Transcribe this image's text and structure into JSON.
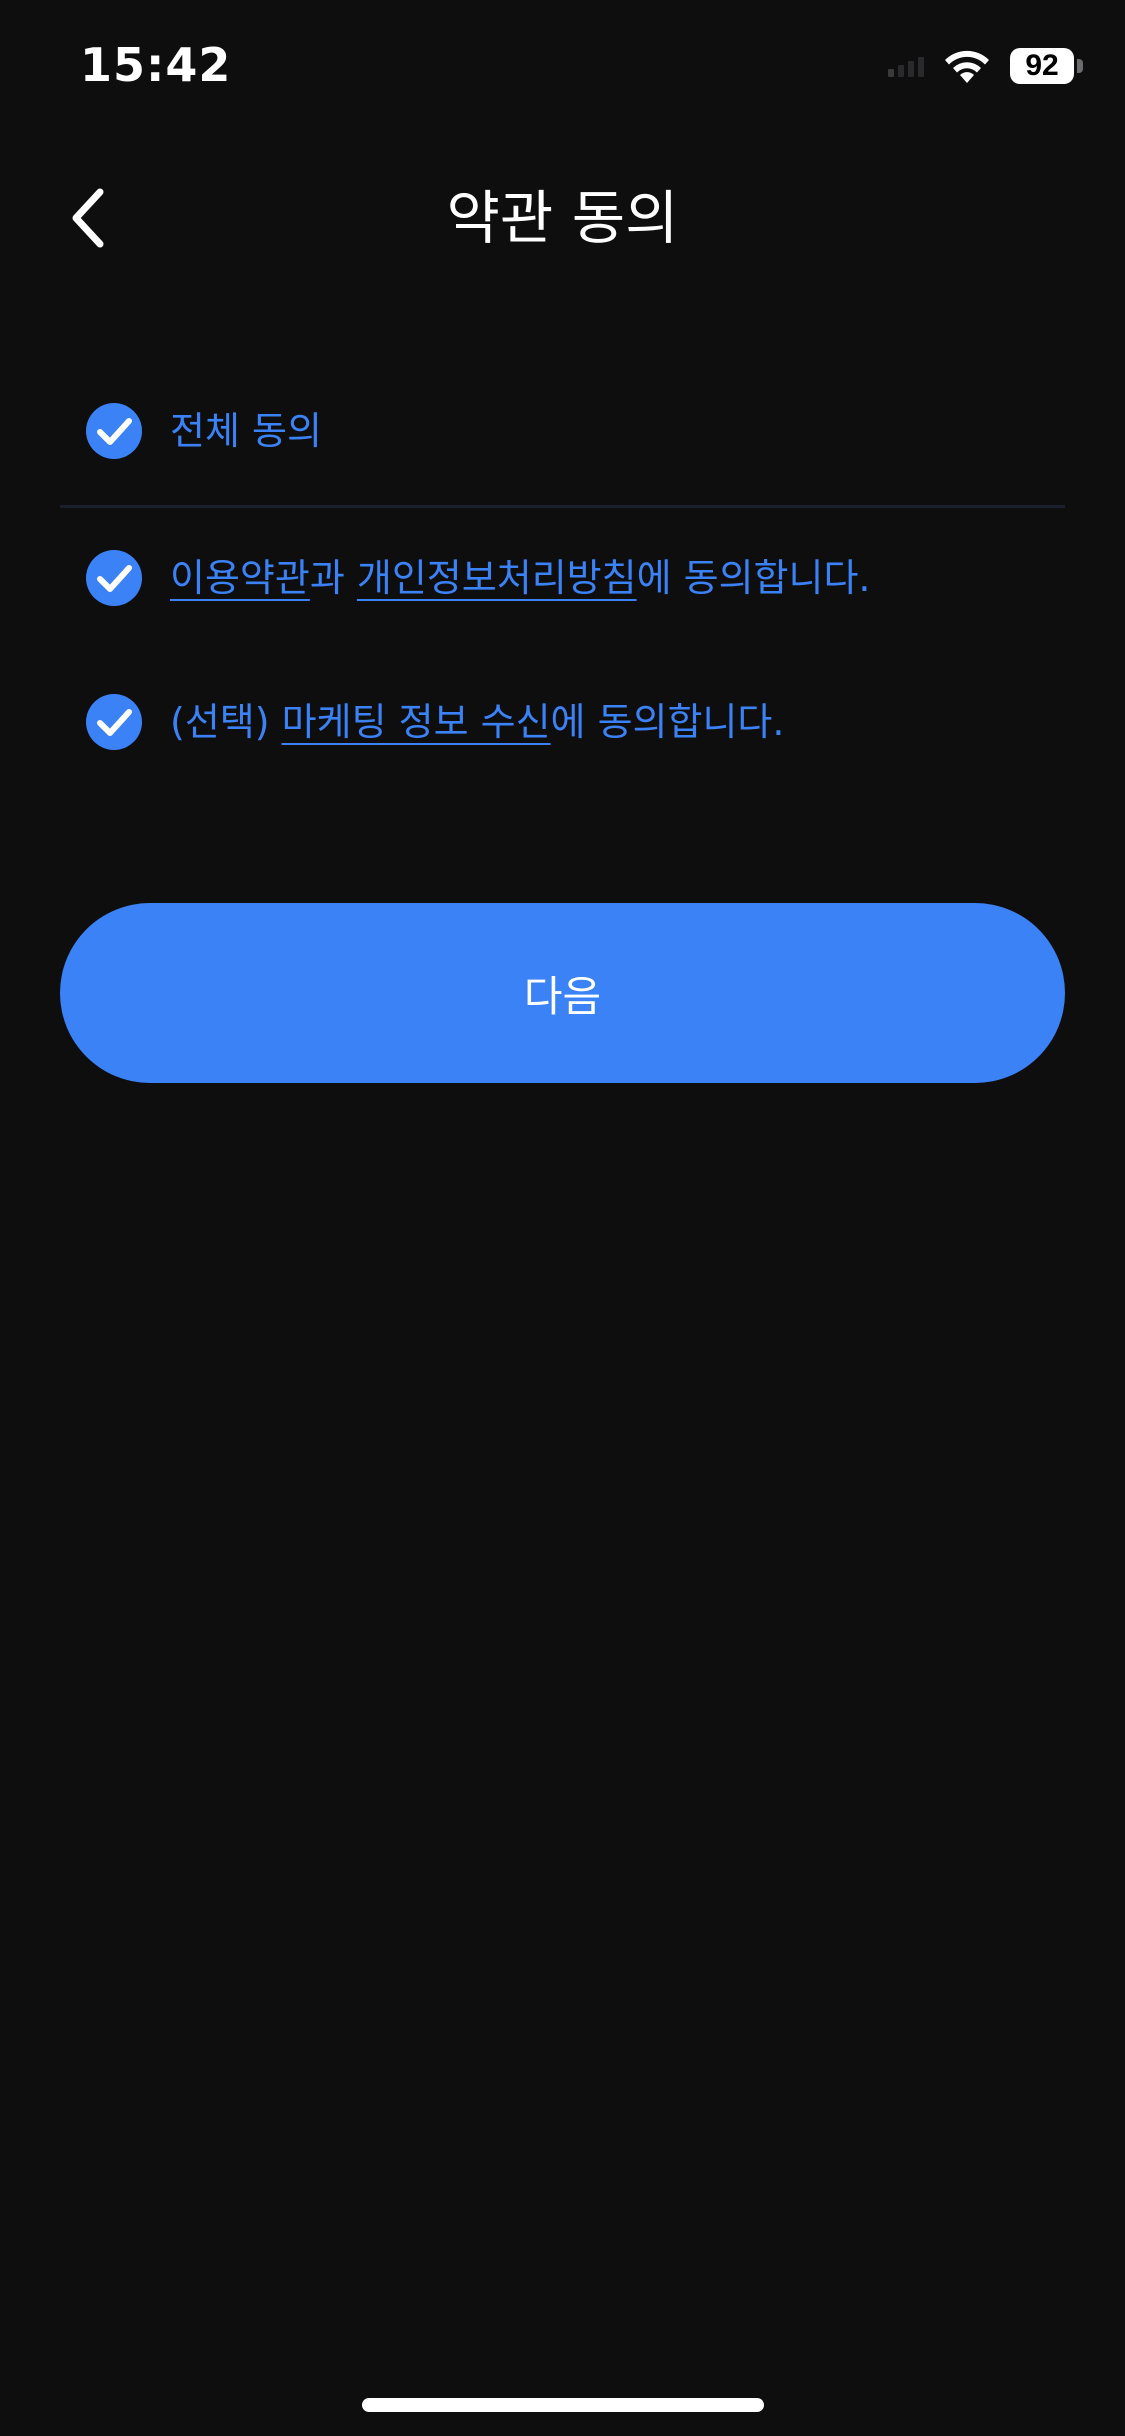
{
  "status_bar": {
    "time": "15:42",
    "battery_level": "92"
  },
  "header": {
    "title": "약관 동의",
    "back_icon": "chevron-left-icon"
  },
  "agreements": {
    "all": {
      "checked": true,
      "label": "전체 동의"
    },
    "terms": {
      "checked": true,
      "link1": "이용약관",
      "connector": "과 ",
      "link2": "개인정보처리방침",
      "suffix": "에 동의합니다."
    },
    "marketing": {
      "checked": true,
      "prefix": "(선택) ",
      "link": "마케팅 정보 수신",
      "suffix": "에 동의합니다."
    }
  },
  "next_button": {
    "label": "다음"
  },
  "colors": {
    "background": "#0e0e0f",
    "accent": "#3b82f6",
    "text": "#ffffff"
  }
}
